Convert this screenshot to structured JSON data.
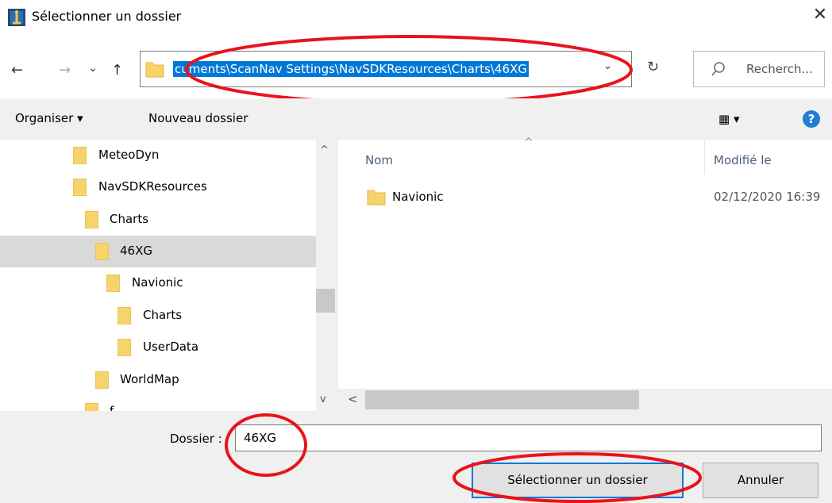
{
  "window": {
    "title": "Sélectionner un dossier",
    "close_glyph": "✕"
  },
  "nav": {
    "back_glyph": "←",
    "forward_glyph": "→",
    "dropdown_glyph": "⌄",
    "up_glyph": "↑",
    "address": "cuments\\ScanNav Settings\\NavSDKResources\\Charts\\46XG",
    "address_chevron": "⌄",
    "refresh_glyph": "↻",
    "search_placeholder": "Recherch..."
  },
  "toolbar": {
    "organise_label": "Organiser ▾",
    "new_folder_label": "Nouveau dossier",
    "view_label": "▦ ▾",
    "help_label": "?"
  },
  "tree": {
    "items": [
      {
        "label": "MeteoDyn"
      },
      {
        "label": "NavSDKResources"
      },
      {
        "label": "Charts"
      },
      {
        "label": "46XG"
      },
      {
        "label": "Navionic"
      },
      {
        "label": "Charts"
      },
      {
        "label": "UserData"
      },
      {
        "label": "WorldMap"
      },
      {
        "label": "f..."
      }
    ],
    "scroll_up": "^",
    "scroll_down": "v"
  },
  "files": {
    "columns": {
      "name": "Nom",
      "modified": "Modifié le"
    },
    "sort_caret": "^",
    "rows": [
      {
        "name": "Navionic",
        "modified": "02/12/2020 16:39"
      }
    ],
    "scroll_left": "<"
  },
  "footer": {
    "folder_label": "Dossier :",
    "folder_value": "46XG",
    "select_button": "Sélectionner un dossier",
    "cancel_button": "Annuler"
  },
  "colors": {
    "accent": "#0078d7",
    "annotation": "#e8141c",
    "folder": "#f6d46b",
    "folder_dark": "#e3b443"
  },
  "icons": {
    "app": "anchor-app-icon",
    "folder": "folder-icon",
    "search": "search-icon"
  }
}
